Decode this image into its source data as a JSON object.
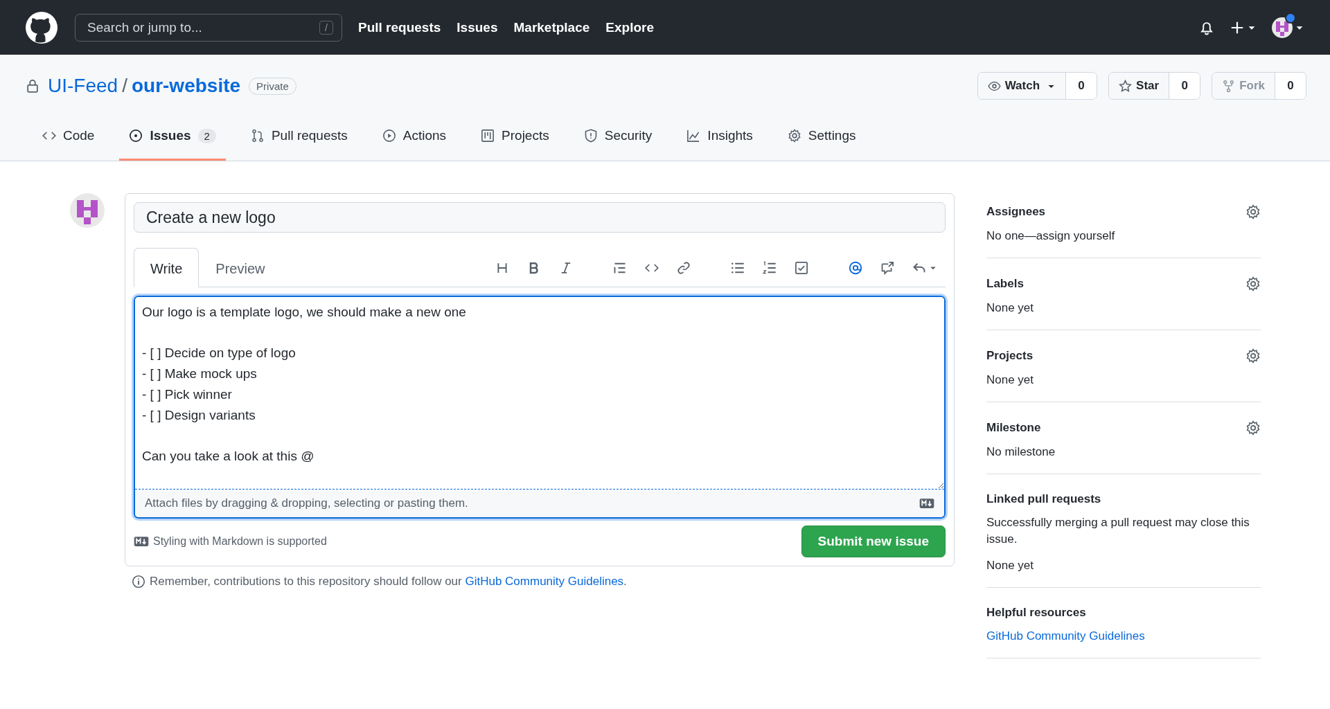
{
  "header": {
    "search_placeholder": "Search or jump to...",
    "search_key": "/",
    "nav": [
      "Pull requests",
      "Issues",
      "Marketplace",
      "Explore"
    ],
    "notification_dot": true
  },
  "repo": {
    "owner": "UI-Feed",
    "separator": "/",
    "name": "our-website",
    "visibility": "Private",
    "actions": [
      {
        "kind": "watch",
        "label": "Watch",
        "count": "0",
        "disabled": false
      },
      {
        "kind": "star",
        "label": "Star",
        "count": "0",
        "disabled": false
      },
      {
        "kind": "fork",
        "label": "Fork",
        "count": "0",
        "disabled": true
      }
    ]
  },
  "tabs": [
    {
      "label": "Code",
      "selected": false
    },
    {
      "label": "Issues",
      "counter": "2",
      "selected": true
    },
    {
      "label": "Pull requests",
      "selected": false
    },
    {
      "label": "Actions",
      "selected": false
    },
    {
      "label": "Projects",
      "selected": false
    },
    {
      "label": "Security",
      "selected": false
    },
    {
      "label": "Insights",
      "selected": false
    },
    {
      "label": "Settings",
      "selected": false
    }
  ],
  "issue_form": {
    "title": "Create a new logo",
    "editor_tabs": [
      {
        "label": "Write",
        "selected": true
      },
      {
        "label": "Preview",
        "selected": false
      }
    ],
    "toolbar": [
      {
        "kind": "heading",
        "active": false
      },
      {
        "kind": "bold",
        "active": false
      },
      {
        "kind": "italic",
        "active": false
      },
      {
        "kind": "gap"
      },
      {
        "kind": "quote",
        "active": false
      },
      {
        "kind": "code",
        "active": false
      },
      {
        "kind": "link",
        "active": false
      },
      {
        "kind": "gap"
      },
      {
        "kind": "bullets",
        "active": false
      },
      {
        "kind": "numbers",
        "active": false
      },
      {
        "kind": "tasks",
        "active": false
      },
      {
        "kind": "gap"
      },
      {
        "kind": "mention",
        "active": true
      },
      {
        "kind": "reference",
        "active": false
      },
      {
        "kind": "reply",
        "active": false
      }
    ],
    "body": "Our logo is a template logo, we should make a new one\n\n- [ ] Decide on type of logo\n- [ ] Make mock ups\n- [ ] Pick winner\n- [ ] Design variants\n\nCan you take a look at this @",
    "attach_hint": "Attach files by dragging & dropping, selecting or pasting them.",
    "markdown_note": "Styling with Markdown is supported",
    "submit": "Submit new issue"
  },
  "footer_note": {
    "text": "Remember, contributions to this repository should follow our ",
    "link": "GitHub Community Guidelines",
    "end": "."
  },
  "sidebar": [
    {
      "title": "Assignees",
      "settings": true,
      "lines": [
        "No one—assign yourself"
      ]
    },
    {
      "title": "Labels",
      "settings": true,
      "lines": [
        "None yet"
      ]
    },
    {
      "title": "Projects",
      "settings": true,
      "lines": [
        "None yet"
      ]
    },
    {
      "title": "Milestone",
      "settings": true,
      "lines": [
        "No milestone"
      ]
    },
    {
      "title": "Linked pull requests",
      "settings": false,
      "lines": [
        "Successfully merging a pull request may close this issue.",
        "None yet"
      ]
    },
    {
      "title": "Helpful resources",
      "settings": false,
      "links": [
        "GitHub Community Guidelines"
      ]
    }
  ]
}
